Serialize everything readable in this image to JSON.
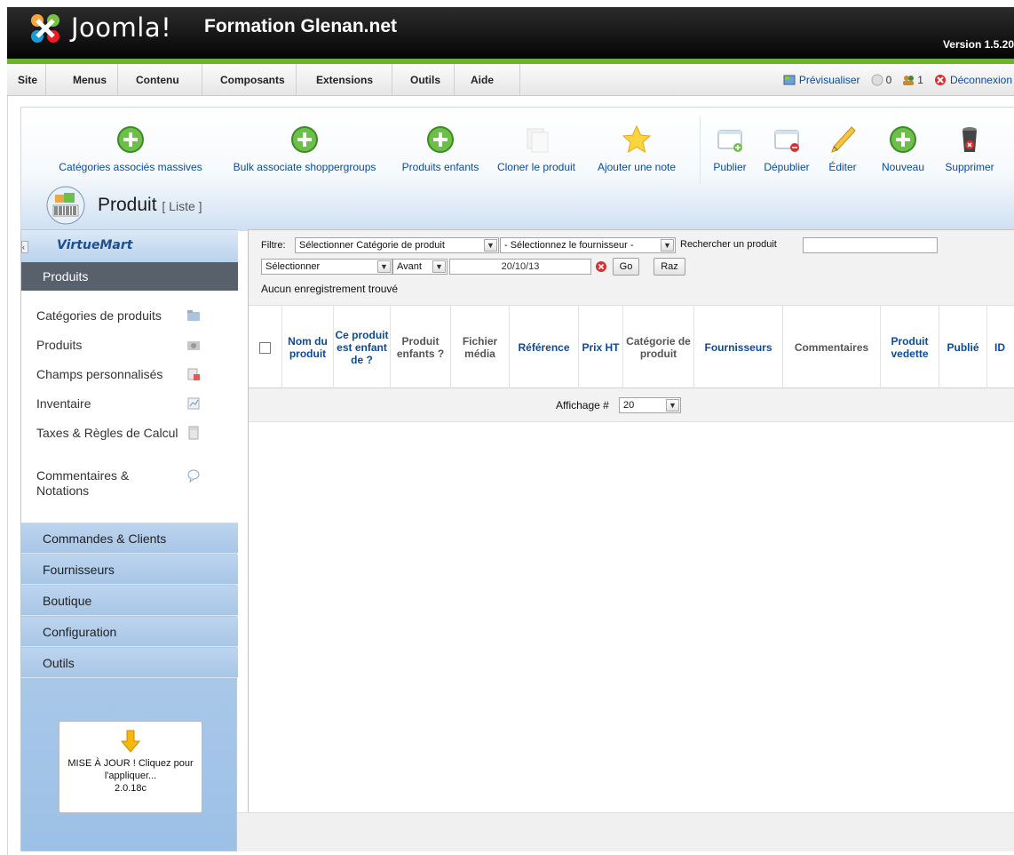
{
  "header": {
    "logo_text": "Joomla!",
    "site_name": "Formation Glenan.net",
    "version": "Version 1.5.20"
  },
  "topmenu": {
    "items": [
      "Site",
      "Menus",
      "Contenu",
      "Composants",
      "Extensions",
      "Outils",
      "Aide"
    ],
    "preview_label": "Prévisualiser",
    "messages_count": "0",
    "users_count": "1",
    "logout_label": "Déconnexion"
  },
  "toolbar": {
    "buttons": [
      {
        "label": "Catégories associés massives",
        "icon": "add-icon"
      },
      {
        "label": "Bulk associate shoppergroups",
        "icon": "add-icon"
      },
      {
        "label": "Produits enfants",
        "icon": "add-icon"
      },
      {
        "label": "Cloner le produit",
        "icon": "copy-icon"
      },
      {
        "label": "Ajouter une note",
        "icon": "star-icon"
      },
      {
        "label": "Publier",
        "icon": "publish-icon"
      },
      {
        "label": "Dépublier",
        "icon": "unpublish-icon"
      },
      {
        "label": "Éditer",
        "icon": "edit-icon"
      },
      {
        "label": "Nouveau",
        "icon": "add-icon"
      },
      {
        "label": "Supprimer",
        "icon": "trash-icon"
      }
    ],
    "title": "Produit",
    "subtitle": "[ Liste ]"
  },
  "sidebar": {
    "logo": "VirtueMart",
    "active_section": "Produits",
    "sub_items": [
      {
        "label": "Catégories de produits",
        "icon": "folder-icon"
      },
      {
        "label": "Produits",
        "icon": "camera-icon"
      },
      {
        "label": "Champs personnalisés",
        "icon": "custom-fields-icon"
      },
      {
        "label": "Inventaire",
        "icon": "inventory-icon"
      },
      {
        "label": "Taxes & Règles de Calcul",
        "icon": "calculator-icon"
      },
      {
        "label": "Commentaires & Notations",
        "icon": "speech-bubble-icon"
      }
    ],
    "sections": [
      "Commandes & Clients",
      "Fournisseurs",
      "Boutique",
      "Configuration",
      "Outils"
    ],
    "update_text": "MISE À JOUR ! Cliquez pour l'appliquer...",
    "update_version": "2.0.18c"
  },
  "filter": {
    "label": "Filtre:",
    "category_select": "Sélectionner Catégorie de produit",
    "vendor_select": "- Sélectionnez le fournisseur -",
    "search_label": "Rechercher un produit",
    "search_value": "",
    "date_type_select": "Sélectionner",
    "date_when_select": "Avant",
    "date_value": "20/10/13",
    "go_label": "Go",
    "reset_label": "Raz",
    "no_records": "Aucun enregistrement trouvé"
  },
  "columns": [
    {
      "label": "Nom du produit",
      "style": "link"
    },
    {
      "label": "Ce produit est enfant de ?",
      "style": "link"
    },
    {
      "label": "Produit enfants ?",
      "style": "plain"
    },
    {
      "label": "Fichier média",
      "style": "plain"
    },
    {
      "label": "Référence",
      "style": "link"
    },
    {
      "label": "Prix HT",
      "style": "link"
    },
    {
      "label": "Catégorie de produit",
      "style": "plain"
    },
    {
      "label": "Fournisseurs",
      "style": "link"
    },
    {
      "label": "Commentaires",
      "style": "plain"
    },
    {
      "label": "Produit vedette",
      "style": "link"
    },
    {
      "label": "Publié",
      "style": "link"
    },
    {
      "label": "ID",
      "style": "link"
    }
  ],
  "pager": {
    "label": "Affichage #",
    "value": "20"
  }
}
